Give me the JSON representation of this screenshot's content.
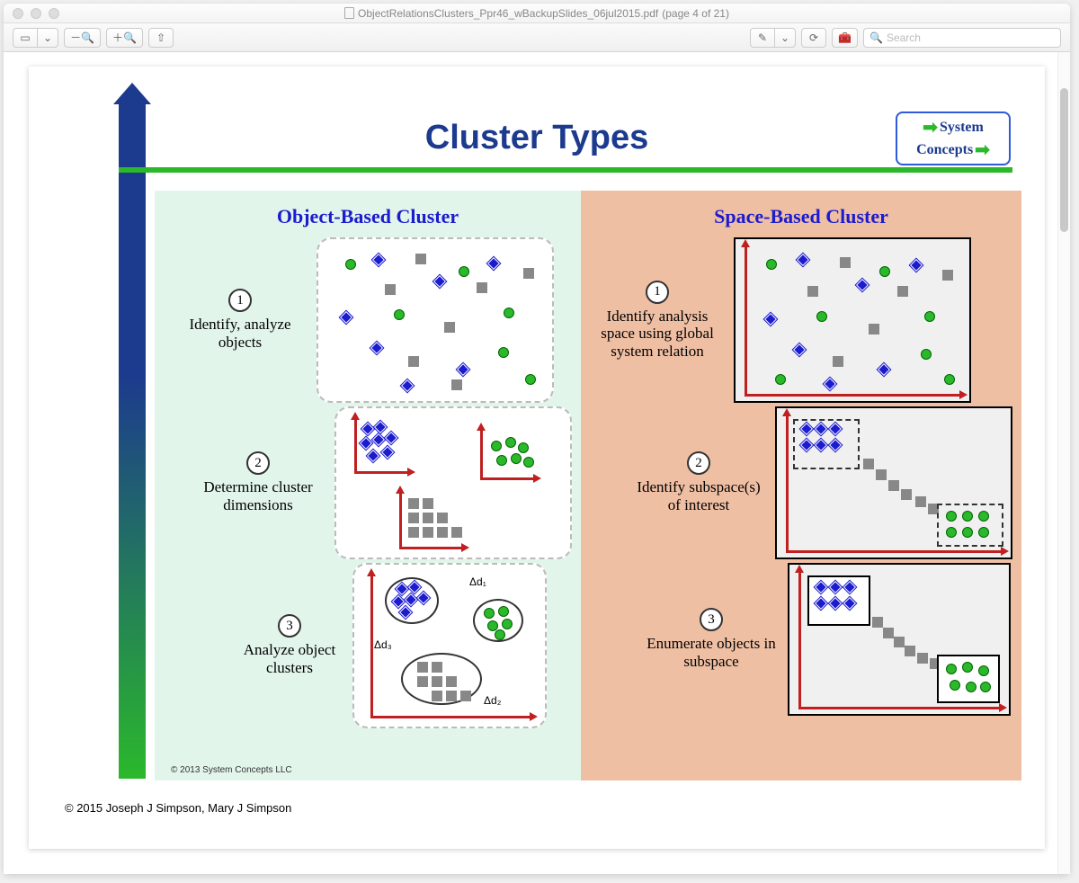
{
  "window": {
    "filename": "ObjectRelationsClusters_Ppr46_wBackupSlides_06jul2015.pdf",
    "page_indicator": "(page 4 of 21)",
    "search_placeholder": "Search"
  },
  "slide": {
    "title": "Cluster Types",
    "logo_line1": "System",
    "logo_line2": "Concepts",
    "left_panel_title": "Object-Based Cluster",
    "right_panel_title": "Space-Based Cluster",
    "left_steps": {
      "s1_num": "1",
      "s1_text": "Identify, analyze objects",
      "s2_num": "2",
      "s2_text": "Determine cluster dimensions",
      "s3_num": "3",
      "s3_text": "Analyze object clusters",
      "d1": "Δd₁",
      "d2": "Δd₂",
      "d3": "Δd₃"
    },
    "right_steps": {
      "s1_num": "1",
      "s1_text": "Identify analysis space using global system relation",
      "s2_num": "2",
      "s2_text": "Identify subspace(s) of interest",
      "s3_num": "3",
      "s3_text": "Enumerate objects in subspace"
    },
    "inner_copyright": "© 2013 System Concepts LLC",
    "outer_copyright": "© 2015  Joseph J Simpson, Mary J Simpson"
  }
}
